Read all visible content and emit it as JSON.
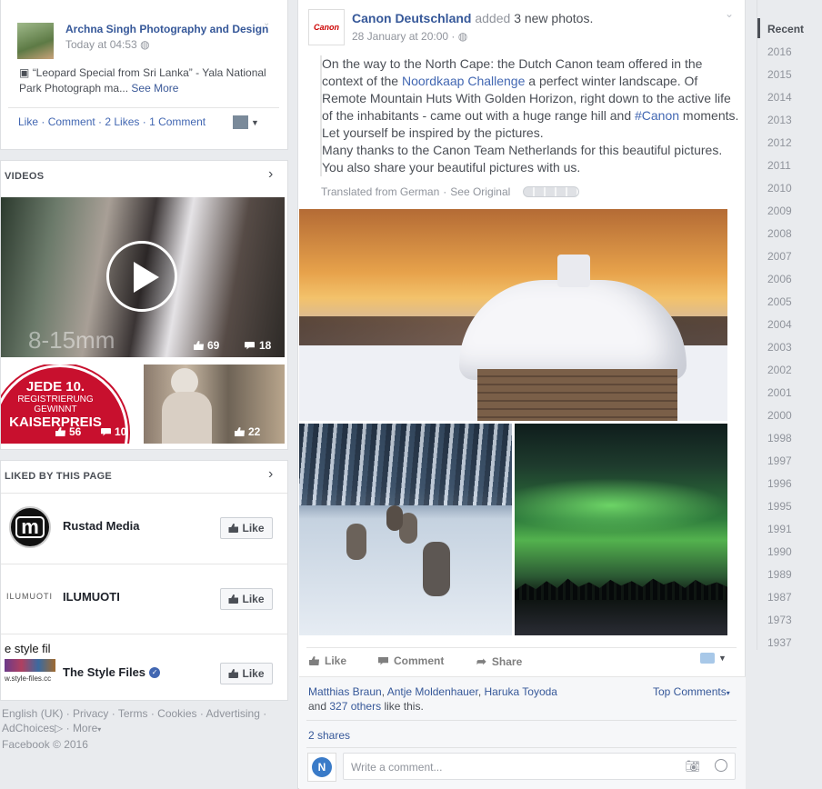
{
  "top_post": {
    "author": "Archna Singh Photography and Design",
    "time": "Today at 04:53",
    "text": "“Leopard Special from Sri Lanka” - Yala National Park Photograph ma...",
    "see_more": "See More",
    "actions": [
      "Like",
      "Comment",
      "2 Likes",
      "1 Comment"
    ]
  },
  "videos": {
    "title": "VIDEOS",
    "main": {
      "overlay": "8-15mm",
      "likes": "69",
      "comments": "18"
    },
    "small1": {
      "line1": "JEDE 10.",
      "line2": "REGISTRIERUNG",
      "line3": "GEWINNT",
      "line4": "KAISERPREIS",
      "likes": "56",
      "comments": "10"
    },
    "small2": {
      "likes": "22"
    }
  },
  "liked": {
    "title": "LIKED BY THIS PAGE",
    "like_label": "Like",
    "pages": [
      {
        "name": "Rustad Media",
        "logo": "m"
      },
      {
        "name": "ILUMUOTI",
        "logo": "ILUMUOTI"
      },
      {
        "name": "The Style Files",
        "logo_top": "e style fil",
        "logo_bottom": "w.style-files.cc"
      }
    ]
  },
  "footer": {
    "line1": [
      "English (UK)",
      "Privacy",
      "Terms",
      "Cookies",
      "Advertising"
    ],
    "adchoices": "AdChoices",
    "more": "More",
    "copyright": "Facebook © 2016"
  },
  "post": {
    "page": "Canon Deutschland",
    "logo": "Canon",
    "action": "added",
    "count": "3 new photos.",
    "time": "28 January at 20:00",
    "text_1": "On the way to the North Cape: the Dutch Canon team offered in the context of the ",
    "link_1": "Noordkaap Challenge",
    "text_2": " a perfect winter landscape. Of Remote Mountain Huts With Golden Horizon, right down to the active life of the inhabitants - came out with a huge range hill and ",
    "hashtag": "#Canon",
    "text_3": " moments. Let yourself be inspired by the pictures.",
    "text_4": "Many thanks to the Canon Team Netherlands for this beautiful pictures. You also share your beautiful pictures with us.",
    "translated": "Translated from German",
    "see_original": "See Original",
    "actions": {
      "like": "Like",
      "comment": "Comment",
      "share": "Share"
    },
    "likers": [
      "Matthias Braun",
      "Antje Moldenhauer",
      "Haruka Toyoda"
    ],
    "likers_and": "and",
    "others": "327 others",
    "likers_suffix": "like this.",
    "top_comments": "Top Comments",
    "shares": "2 shares",
    "comment_placeholder": "Write a comment..."
  },
  "timeline": {
    "recent": "Recent",
    "years": [
      "2016",
      "2015",
      "2014",
      "2013",
      "2012",
      "2011",
      "2010",
      "2009",
      "2008",
      "2007",
      "2006",
      "2005",
      "2004",
      "2003",
      "2002",
      "2001",
      "2000",
      "1998",
      "1997",
      "1996",
      "1995",
      "1991",
      "1990",
      "1989",
      "1987",
      "1973",
      "1937"
    ]
  },
  "colors": {
    "link": "#3b5998",
    "bg": "#e9ebee",
    "aurora": "#3fbf4f"
  }
}
